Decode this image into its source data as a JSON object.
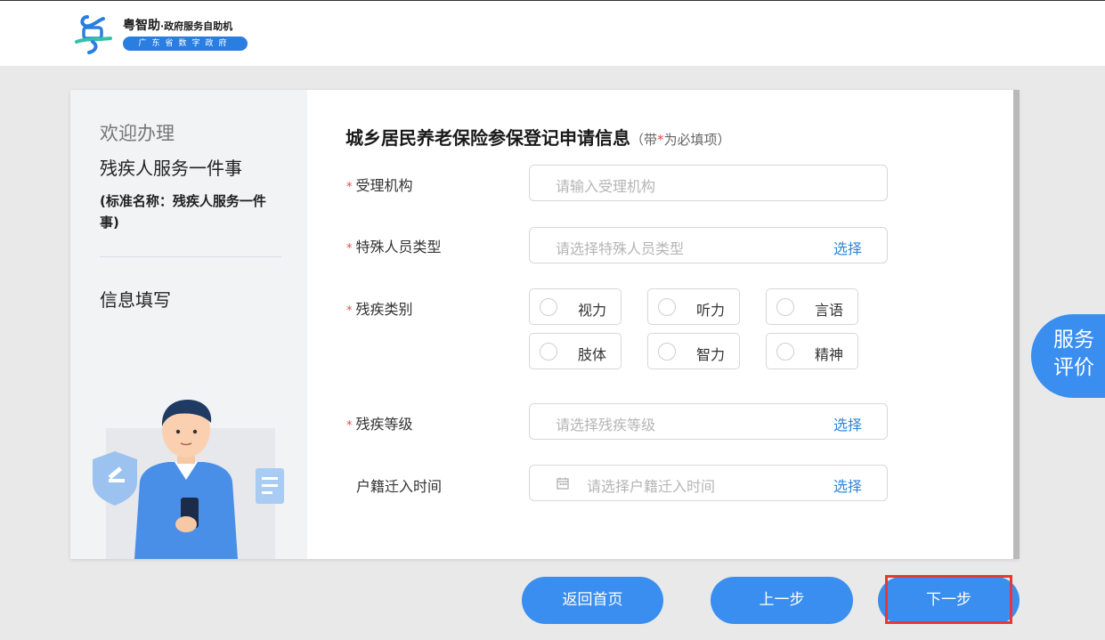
{
  "header": {
    "brand": "粤智助",
    "brand_suffix": "·政府服务自助机",
    "pill_text": "广东省数字政府",
    "logo_icon": "yue-logo-icon",
    "brand_color": "#2a7ee0"
  },
  "sidebar": {
    "welcome": "欢迎办理",
    "service_name": "残疾人服务一件事",
    "standard_name": "(标准名称：残疾人服务一件事)",
    "step": "信息填写",
    "illustration_icon": "officer-illustration-icon"
  },
  "form": {
    "title": "城乡居民养老保险参保登记申请信息",
    "note_prefix": "（带",
    "note_star": "*",
    "note_suffix": "为必填项）",
    "fields": [
      {
        "label": "受理机构",
        "required": true,
        "placeholder": "请输入受理机构"
      },
      {
        "label": "特殊人员类型",
        "required": true,
        "placeholder": "请选择特殊人员类型",
        "action": "选择"
      },
      {
        "label": "残疾类别",
        "required": true
      },
      {
        "label": "残疾等级",
        "required": true,
        "placeholder": "请选择残疾等级",
        "action": "选择"
      },
      {
        "label": "户籍迁入时间",
        "required": false,
        "placeholder": "请选择户籍迁入时间",
        "action": "选择",
        "icon": "calendar-icon"
      }
    ],
    "disability_options": [
      "视力",
      "听力",
      "言语",
      "肢体",
      "智力",
      "精神"
    ],
    "required_mark": "*"
  },
  "rating_button": {
    "line1": "服务",
    "line2": "评价"
  },
  "buttons": {
    "home": "返回首页",
    "prev": "上一步",
    "next": "下一步"
  },
  "colors": {
    "accent": "#3a8ef0",
    "required": "#e04b4b",
    "highlight": "#e53935",
    "link": "#2f86d6"
  }
}
